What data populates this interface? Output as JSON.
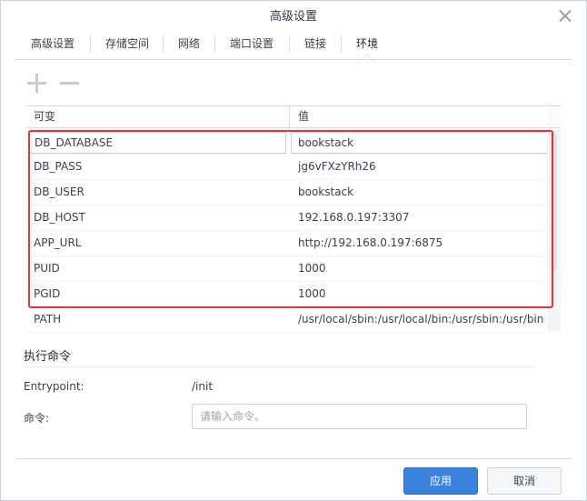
{
  "dialog": {
    "title": "高级设置"
  },
  "tabs": [
    {
      "label": "高级设置"
    },
    {
      "label": "存储空间"
    },
    {
      "label": "网络"
    },
    {
      "label": "端口设置"
    },
    {
      "label": "链接"
    },
    {
      "label": "环境",
      "active": true
    }
  ],
  "toolbar": {
    "add_icon": "plus-icon",
    "remove_icon": "minus-icon"
  },
  "env_table": {
    "columns": [
      "可变",
      "值"
    ],
    "rows": [
      {
        "key": "DB_DATABASE",
        "value": "bookstack"
      },
      {
        "key": "DB_PASS",
        "value": "jg6vFXzYRh26"
      },
      {
        "key": "DB_USER",
        "value": "bookstack"
      },
      {
        "key": "DB_HOST",
        "value": "192.168.0.197:3307"
      },
      {
        "key": "APP_URL",
        "value": "http://192.168.0.197:6875"
      },
      {
        "key": "PUID",
        "value": "1000"
      },
      {
        "key": "PGID",
        "value": "1000"
      },
      {
        "key": "PATH",
        "value": "/usr/local/sbin:/usr/local/bin:/usr/sbin:/usr/bin:/sbin:/bin"
      }
    ]
  },
  "exec": {
    "section_title": "执行命令",
    "entrypoint_label": "Entrypoint:",
    "entrypoint_value": "/init",
    "command_label": "命令:",
    "command_placeholder": "请输入命令。",
    "command_value": ""
  },
  "footer": {
    "apply_label": "应用",
    "cancel_label": "取消"
  },
  "colors": {
    "primary": "#3b82dc",
    "highlight": "#e8323c"
  }
}
